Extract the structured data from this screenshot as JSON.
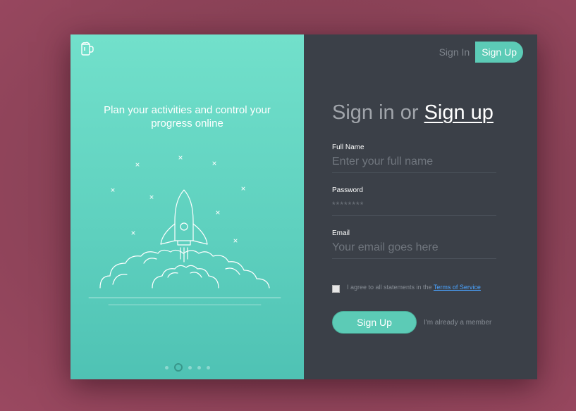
{
  "left_panel": {
    "tagline_line1": "Plan your activities and control your",
    "tagline_line2": "progress online",
    "logo_icon": "coffee-cup-icon",
    "carousel": {
      "count": 5,
      "active_index": 1
    }
  },
  "nav": {
    "sign_in": "Sign In",
    "sign_up": "Sign Up"
  },
  "form": {
    "heading_prefix": "Sign in or",
    "heading_link": "Sign up",
    "full_name": {
      "label": "Full Name",
      "placeholder": "Enter your full name"
    },
    "password": {
      "label": "Password",
      "placeholder": "********"
    },
    "email": {
      "label": "Email",
      "placeholder": "Your email goes here"
    },
    "agree_text": "I agree to all statements in the",
    "terms_link": "Terms of Service",
    "submit_label": "Sign Up",
    "member_link": "I'm already a member"
  },
  "colors": {
    "accent": "#5ccbb6",
    "left_gradient_top": "#72e0cb",
    "left_gradient_bottom": "#4fc2b4",
    "panel_dark": "#3b4048",
    "background": "#8a4257",
    "link": "#4aa3ff"
  }
}
